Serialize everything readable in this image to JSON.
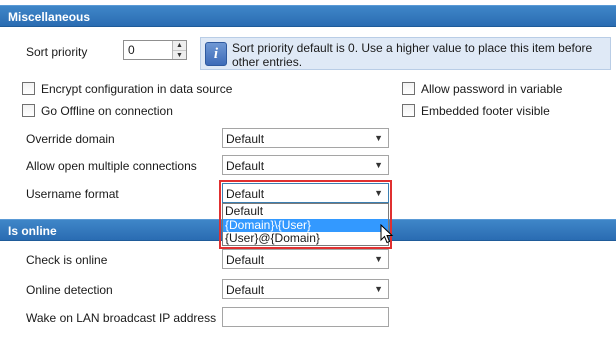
{
  "sections": {
    "misc_title": "Miscellaneous",
    "online_title": "Is online"
  },
  "sort_priority": {
    "label": "Sort priority",
    "value": "0",
    "info_text": "Sort priority default is 0. Use a higher value to place this item before other entries."
  },
  "checkboxes": {
    "encrypt": {
      "label": "Encrypt configuration in data source",
      "checked": false
    },
    "offline": {
      "label": "Go Offline on connection",
      "checked": false
    },
    "allow_password": {
      "label": "Allow password in variable",
      "checked": false
    },
    "footer": {
      "label": "Embedded footer visible",
      "checked": false
    }
  },
  "fields": {
    "override_domain": {
      "label": "Override domain",
      "value": "Default"
    },
    "multiple_connections": {
      "label": "Allow open multiple connections",
      "value": "Default"
    },
    "username_format": {
      "label": "Username format",
      "value": "Default",
      "options": [
        "Default",
        "{Domain}\\{User}",
        "{User}@{Domain}"
      ],
      "highlighted_option": 1
    },
    "check_online": {
      "label": "Check is online",
      "value": "Default"
    },
    "online_detection": {
      "label": "Online detection",
      "value": "Default"
    },
    "wake_on_lan": {
      "label": "Wake on LAN broadcast IP address",
      "value": ""
    }
  },
  "colors": {
    "section_header": "#2a6cb2",
    "selection": "#3399ff",
    "highlight_border": "#e03030",
    "info_background": "#dfe9f6"
  },
  "icons": {
    "info": "info-icon",
    "spin_up": "chevron-up-icon",
    "spin_down": "chevron-down-icon",
    "combo_arrow": "chevron-down-icon",
    "cursor": "mouse-pointer-icon"
  }
}
